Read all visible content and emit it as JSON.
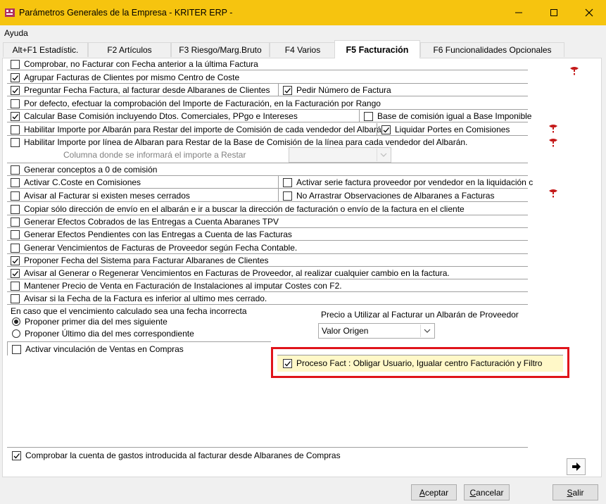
{
  "window": {
    "title": "Parámetros Generales de la Empresa - KRITER ERP -"
  },
  "menu": [
    "Ayuda"
  ],
  "tabs": [
    {
      "label": "Alt+F1 Estadístic."
    },
    {
      "label": "F2 Artículos"
    },
    {
      "label": "F3 Riesgo/Marg.Bruto"
    },
    {
      "label": "F4 Varios"
    },
    {
      "label": "F5 Facturación",
      "active": true
    },
    {
      "label": "F6 Funcionalidades Opcionales"
    }
  ],
  "options": {
    "o1": {
      "label": "Comprobar, no Facturar con Fecha anterior a la última Factura",
      "checked": false
    },
    "o2": {
      "label": "Agrupar Facturas de Clientes por mismo Centro de Coste",
      "checked": true
    },
    "o3": {
      "label": "Preguntar Fecha Factura, al facturar desde Albaranes de Clientes",
      "checked": true
    },
    "o3b": {
      "label": "Pedir Número de Factura",
      "checked": true
    },
    "o4": {
      "label": "Por defecto, efectuar la comprobación del Importe de Facturación, en la Facturación por Rango",
      "checked": false
    },
    "o5": {
      "label": "Calcular Base Comisión incluyendo Dtos. Comerciales, PPgo e Intereses",
      "checked": true
    },
    "o5b": {
      "label": "Base de comisión igual a Base Imponible",
      "checked": false
    },
    "o6": {
      "label": "Habilitar Importe por Albarán para Restar del importe de Comisión de cada vendedor del Albarán",
      "checked": false
    },
    "o6b": {
      "label": "Liquidar Portes en Comisiones",
      "checked": true
    },
    "o7": {
      "label": "Habilitar Importe por línea de Albaran para Restar de la Base de Comisión de la línea para cada vendedor del Albarán.",
      "checked": false
    },
    "o7_sub": "Columna donde se informará el importe a Restar",
    "o8": {
      "label": "Generar conceptos a 0 de comisión",
      "checked": false
    },
    "o9": {
      "label": "Activar C.Coste en Comisiones",
      "checked": false
    },
    "o9b": {
      "label": "Activar serie factura proveedor por vendedor en la liquidación c",
      "checked": false
    },
    "o10": {
      "label": "Avisar al Facturar si existen meses cerrados",
      "checked": false
    },
    "o10b": {
      "label": "No Arrastrar Observaciones de Albaranes a Facturas",
      "checked": false
    },
    "o11": {
      "label": "Copiar sólo dirección de envío en el albarán e ir a buscar la dirección de facturación o envío de la factura en el cliente",
      "checked": false
    },
    "o12": {
      "label": "Generar Efectos Cobrados de las Entregas a Cuenta Abaranes TPV",
      "checked": false
    },
    "o13": {
      "label": "Generar Efectos Pendientes con las Entregas a Cuenta de las Facturas",
      "checked": false
    },
    "o14": {
      "label": "Generar Vencimientos de Facturas de Proveedor según Fecha Contable.",
      "checked": false
    },
    "o15": {
      "label": "Proponer Fecha del Sistema para Facturar Albaranes de Clientes",
      "checked": true
    },
    "o16": {
      "label": "Avisar al Generar o Regenerar Vencimientos en Facturas de Proveedor, al realizar cualquier cambio en la factura.",
      "checked": true
    },
    "o17": {
      "label": "Mantener Precio de Venta en Facturación de Instalaciones al imputar Costes con F2.",
      "checked": false
    },
    "o18": {
      "label": "Avisar si la Fecha de la Factura es inferior al ultimo mes cerrado.",
      "checked": false
    }
  },
  "vencimiento": {
    "caption": "En caso que el vencimiento calculado sea una fecha incorrecta",
    "r1": {
      "label": "Proponer primer dia del mes siguiente",
      "selected": true
    },
    "r2": {
      "label": "Proponer Último dia del mes correspondiente",
      "selected": false
    }
  },
  "precio": {
    "caption": "Precio a Utilizar al Facturar un Albarán de Proveedor",
    "value": "Valor Origen"
  },
  "ventas_compras": {
    "label": "Activar vinculación de Ventas en Compras",
    "checked": false
  },
  "proceso_fact": {
    "label": "Proceso Fact : Obligar Usuario, Igualar centro Facturación y Filtro",
    "checked": true
  },
  "cuenta_gastos": {
    "label": "Comprobar la cuenta de gastos introducida al facturar desde Albaranes de Compras",
    "checked": true
  },
  "buttons": {
    "accept": {
      "first": "A",
      "rest": "ceptar"
    },
    "cancel": {
      "first": "C",
      "rest": "ancelar"
    },
    "exit": {
      "first": "S",
      "rest": "alir"
    }
  },
  "colors": {
    "titlebar": "#f6c40f",
    "highlight": "#e0141b"
  }
}
